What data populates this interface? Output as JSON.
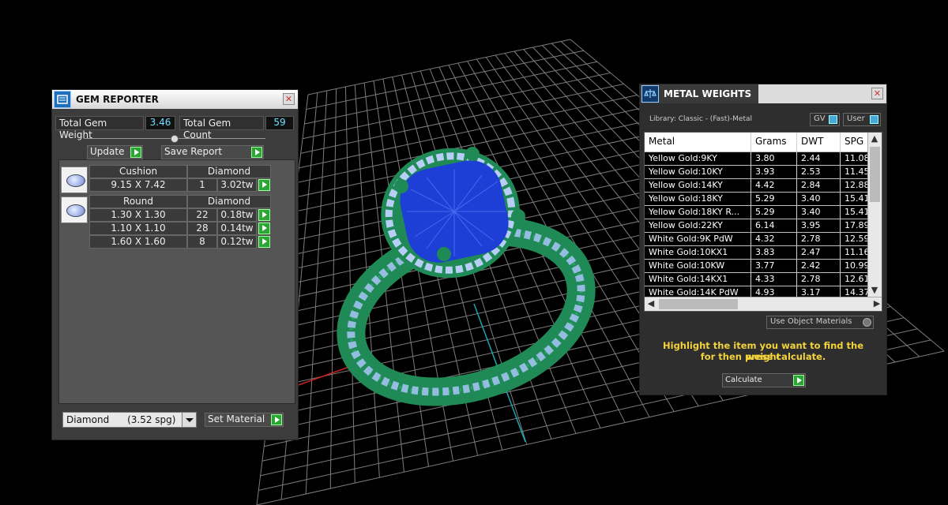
{
  "viewport": {
    "background": "#000000",
    "grid_color": "#9a9a9a",
    "ring_green": "#1f8a55",
    "gem_blue": "#1e3fd6",
    "side_stone_blue": "#9db8f5"
  },
  "gem_reporter": {
    "title": "GEM REPORTER",
    "close_icon": "close-icon",
    "total_gem_weight_label": "Total Gem Weight",
    "total_gem_weight_value": "3.46",
    "total_gem_count_label": "Total Gem Count",
    "total_gem_count_value": "59",
    "update_label": "Update",
    "save_report_label": "Save Report",
    "groups": [
      {
        "shape": "Cushion",
        "material": "Diamond",
        "rows": [
          {
            "size": "9.15 X 7.42",
            "count": "1",
            "weight": "3.02tw"
          }
        ]
      },
      {
        "shape": "Round",
        "material": "Diamond",
        "rows": [
          {
            "size": "1.30 X 1.30",
            "count": "22",
            "weight": "0.18tw"
          },
          {
            "size": "1.10 X 1.10",
            "count": "28",
            "weight": "0.14tw"
          },
          {
            "size": "1.60 X 1.60",
            "count": "8",
            "weight": "0.12tw"
          }
        ]
      }
    ],
    "material_select": "Diamond      (3.52 spg)",
    "set_material_label": "Set Material"
  },
  "metal_weights": {
    "title": "METAL WEIGHTS",
    "library_label": "Library: Classic - (Fast)-Metal",
    "gv_label": "GV",
    "user_label": "User",
    "columns": [
      "Metal",
      "Grams",
      "DWT",
      "SPG"
    ],
    "rows": [
      [
        "Yellow Gold:9KY",
        "3.80",
        "2.44",
        "11.08"
      ],
      [
        "Yellow Gold:10KY",
        "3.93",
        "2.53",
        "11.45"
      ],
      [
        "Yellow Gold:14KY",
        "4.42",
        "2.84",
        "12.88"
      ],
      [
        "Yellow Gold:18KY",
        "5.29",
        "3.40",
        "15.41"
      ],
      [
        "Yellow Gold:18KY R...",
        "5.29",
        "3.40",
        "15.41"
      ],
      [
        "Yellow Gold:22KY",
        "6.14",
        "3.95",
        "17.89"
      ],
      [
        "White Gold:9K PdW",
        "4.32",
        "2.78",
        "12.59"
      ],
      [
        "White Gold:10KX1",
        "3.83",
        "2.47",
        "11.16"
      ],
      [
        "White Gold:10KW",
        "3.77",
        "2.42",
        "10.99"
      ],
      [
        "White Gold:14KX1",
        "4.33",
        "2.78",
        "12.61"
      ],
      [
        "White Gold:14K PdW",
        "4.93",
        "3.17",
        "14.37"
      ]
    ],
    "use_object_materials_label": "Use Object Materials",
    "hint_line1": "Highlight the item you want to find the weight",
    "hint_line2": "for then press calculate.",
    "calculate_label": "Calculate"
  }
}
